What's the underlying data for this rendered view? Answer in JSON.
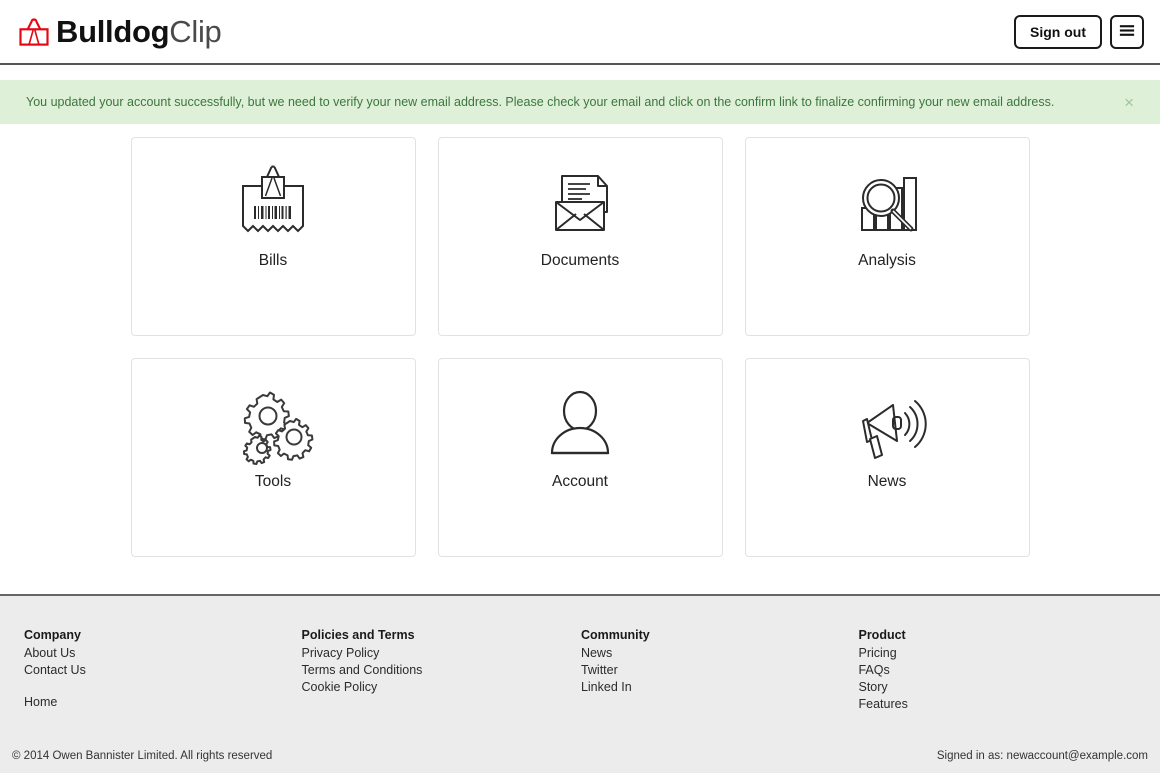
{
  "header": {
    "brand_bold": "Bulldog",
    "brand_light": "Clip",
    "brand_icon": "binder-clip-icon",
    "brand_color": "#e30613",
    "sign_out_label": "Sign out",
    "menu_icon": "hamburger-menu-icon"
  },
  "alert": {
    "message": "You updated your account successfully, but we need to verify your new email address. Please check your email and click on the confirm link to finalize confirming your new email address.",
    "close_label": "×",
    "background": "#dff0d8",
    "text_color": "#3c763d"
  },
  "tiles": [
    {
      "label": "Bills",
      "icon": "clipped-bill-barcode-icon"
    },
    {
      "label": "Documents",
      "icon": "envelope-document-icon"
    },
    {
      "label": "Analysis",
      "icon": "magnifier-bar-chart-icon"
    },
    {
      "label": "Tools",
      "icon": "gears-icon"
    },
    {
      "label": "Account",
      "icon": "person-icon"
    },
    {
      "label": "News",
      "icon": "megaphone-icon"
    }
  ],
  "footer": {
    "columns": [
      {
        "title": "Company",
        "links": [
          {
            "label": "About Us",
            "spaced": false
          },
          {
            "label": "Contact Us",
            "spaced": false
          },
          {
            "label": "Home",
            "spaced": true
          }
        ]
      },
      {
        "title": "Policies and Terms",
        "links": [
          {
            "label": "Privacy Policy",
            "spaced": false
          },
          {
            "label": "Terms and Conditions",
            "spaced": false
          },
          {
            "label": "Cookie Policy",
            "spaced": false
          }
        ]
      },
      {
        "title": "Community",
        "links": [
          {
            "label": "News",
            "spaced": false
          },
          {
            "label": "Twitter",
            "spaced": false
          },
          {
            "label": "Linked In",
            "spaced": false
          }
        ]
      },
      {
        "title": "Product",
        "links": [
          {
            "label": "Pricing",
            "spaced": false
          },
          {
            "label": "FAQs",
            "spaced": false
          },
          {
            "label": "Story",
            "spaced": false
          },
          {
            "label": "Features",
            "spaced": false
          }
        ]
      }
    ],
    "copyright": "© 2014 Owen Bannister Limited. All rights reserved",
    "signed_in_as": "Signed in as: newaccount@example.com"
  }
}
